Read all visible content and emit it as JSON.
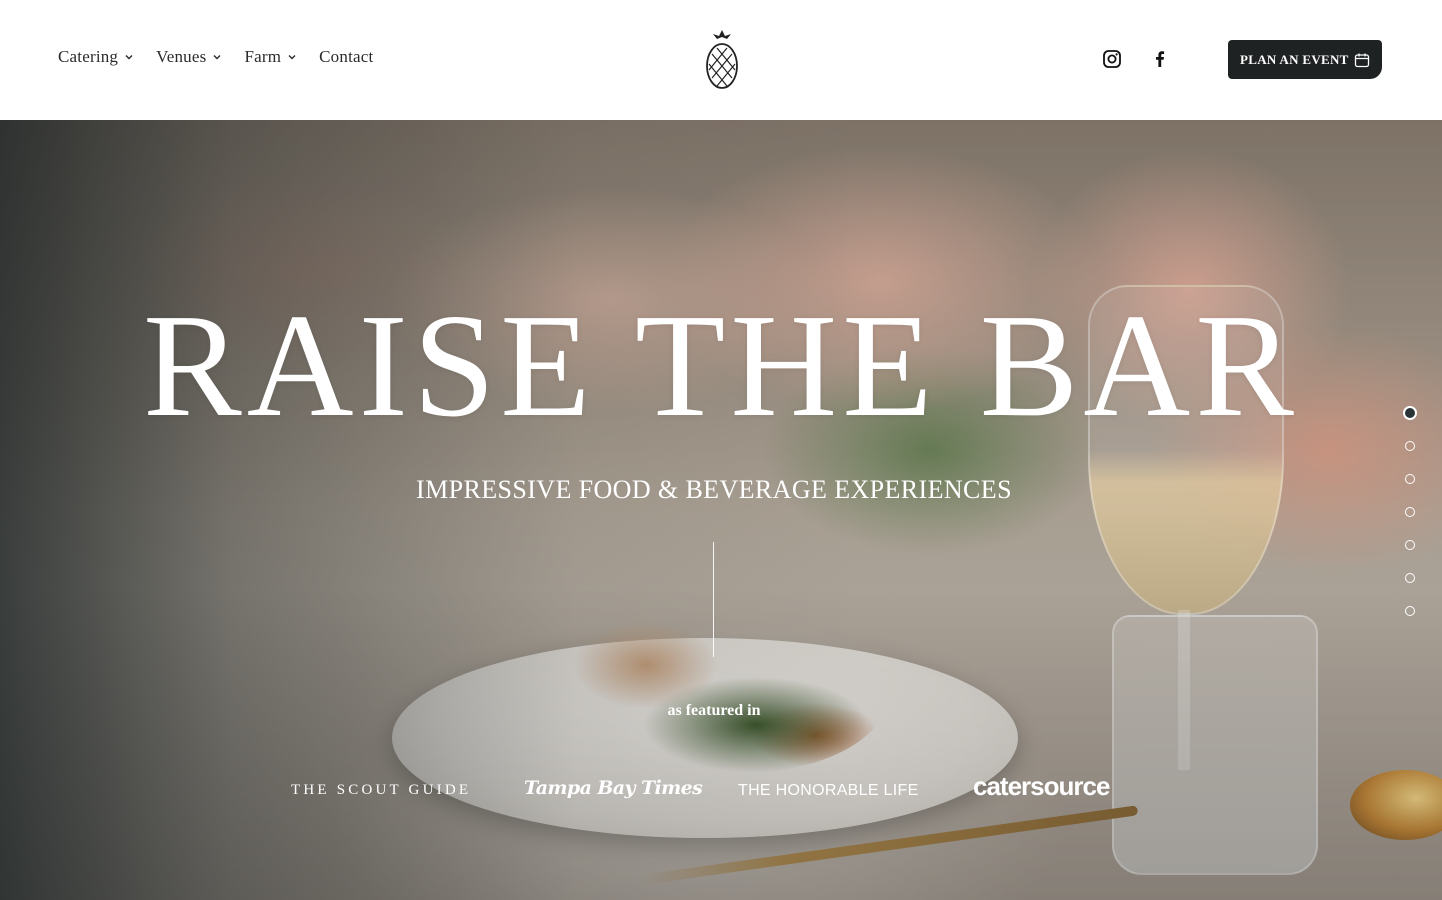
{
  "nav": {
    "items": [
      {
        "label": "Catering",
        "has_dropdown": true
      },
      {
        "label": "Venues",
        "has_dropdown": true
      },
      {
        "label": "Farm",
        "has_dropdown": true
      },
      {
        "label": "Contact",
        "has_dropdown": false
      }
    ]
  },
  "header": {
    "logo_icon": "pineapple-icon",
    "social": [
      {
        "icon": "instagram-icon"
      },
      {
        "icon": "facebook-icon"
      }
    ],
    "cta_label": "PLAN AN EVENT",
    "cta_icon": "calendar-icon",
    "cta_color": "#1f2223"
  },
  "hero": {
    "title": "RAISE THE BAR",
    "subtitle": "IMPRESSIVE FOOD & BEVERAGE EXPERIENCES",
    "featured_label": "as featured in",
    "press_logos": [
      {
        "text": "THE SCOUT GUIDE"
      },
      {
        "text": "Tampa Bay Times"
      },
      {
        "text": "THE HONORABLE LIFE"
      },
      {
        "text": "catersource"
      }
    ]
  },
  "slider": {
    "total_slides": 7,
    "active_index": 0
  }
}
